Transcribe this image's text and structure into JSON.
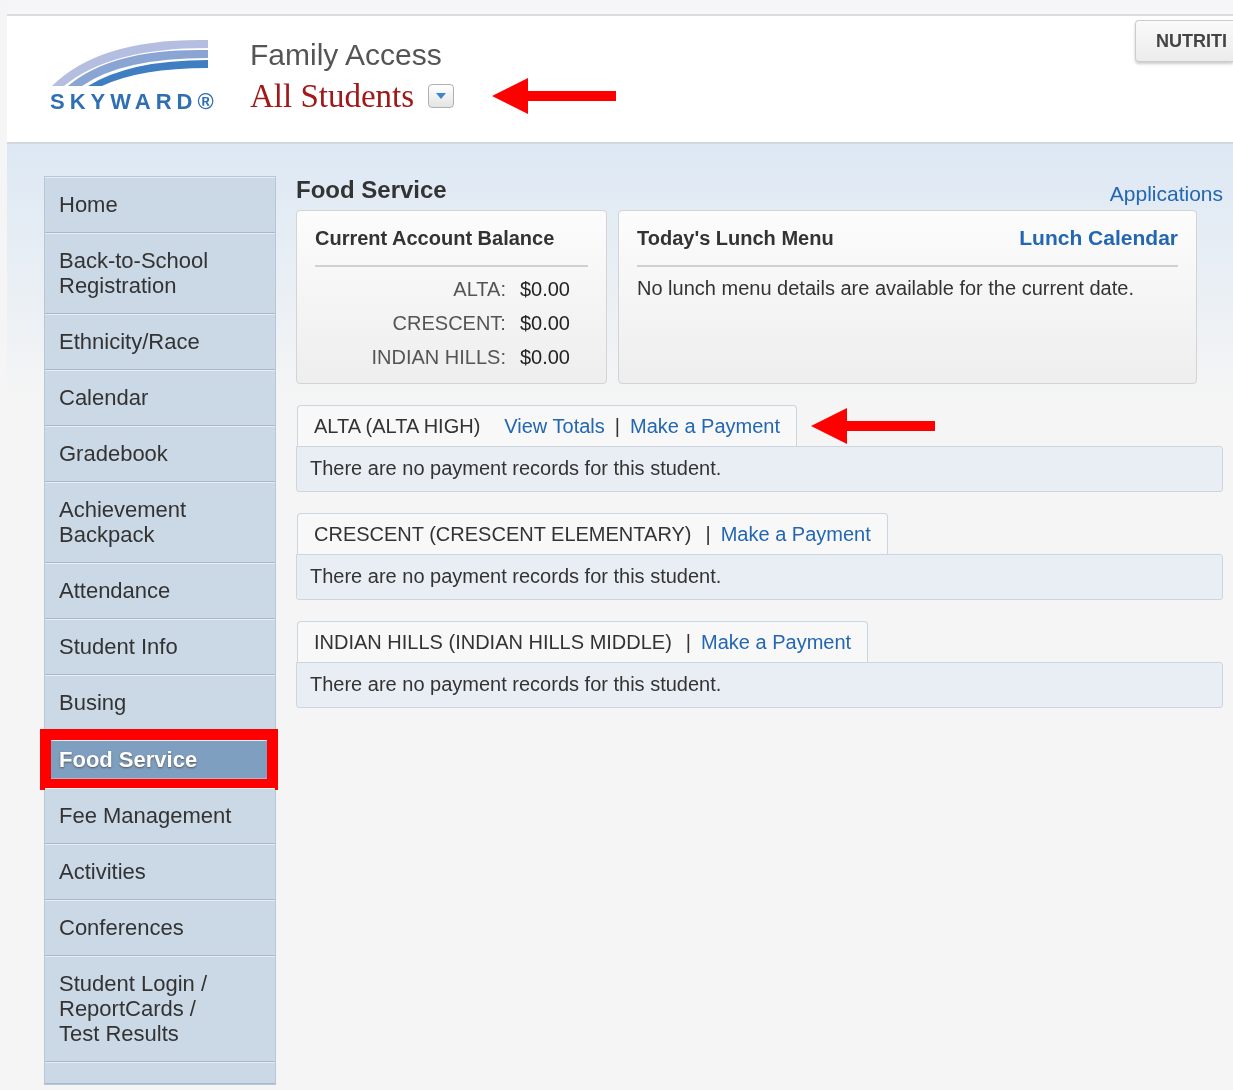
{
  "header": {
    "logo_text": "SKYWARD®",
    "app_title": "Family Access",
    "student_selector": "All Students",
    "nutrition_button": "NUTRITI"
  },
  "sidebar": {
    "items": [
      {
        "label": "Home",
        "selected": false,
        "highlighted": false
      },
      {
        "label": "Back-to-School Registration",
        "selected": false,
        "highlighted": false
      },
      {
        "label": "Ethnicity/Race",
        "selected": false,
        "highlighted": false
      },
      {
        "label": "Calendar",
        "selected": false,
        "highlighted": false
      },
      {
        "label": "Gradebook",
        "selected": false,
        "highlighted": false
      },
      {
        "label": "Achievement Backpack",
        "selected": false,
        "highlighted": false
      },
      {
        "label": "Attendance",
        "selected": false,
        "highlighted": false
      },
      {
        "label": "Student Info",
        "selected": false,
        "highlighted": false
      },
      {
        "label": "Busing",
        "selected": false,
        "highlighted": false
      },
      {
        "label": "Food Service",
        "selected": true,
        "highlighted": true
      },
      {
        "label": "Fee Management",
        "selected": false,
        "highlighted": false
      },
      {
        "label": "Activities",
        "selected": false,
        "highlighted": false
      },
      {
        "label": "Conferences",
        "selected": false,
        "highlighted": false
      },
      {
        "label": "Student Login / ReportCards / Test Results",
        "selected": false,
        "highlighted": false
      }
    ]
  },
  "main": {
    "title": "Food Service",
    "applications_link": "Applications",
    "balance_card": {
      "title": "Current Account Balance",
      "rows": [
        {
          "school": "ALTA:",
          "amount": "$0.00"
        },
        {
          "school": "CRESCENT:",
          "amount": "$0.00"
        },
        {
          "school": "INDIAN HILLS:",
          "amount": "$0.00"
        }
      ]
    },
    "lunch_card": {
      "title": "Today's Lunch Menu",
      "link": "Lunch Calendar",
      "message": "No lunch menu details are available for the current date."
    },
    "schools": [
      {
        "name": "ALTA (ALTA HIGH)",
        "links": [
          {
            "kind": "link",
            "text": "View Totals"
          },
          {
            "kind": "separator",
            "text": "|"
          },
          {
            "kind": "link",
            "text": "Make a Payment"
          }
        ],
        "message": "There are no payment records for this student.",
        "arrow": true
      },
      {
        "name": "CRESCENT (CRESCENT ELEMENTARY)",
        "links": [
          {
            "kind": "separator",
            "text": "|"
          },
          {
            "kind": "link",
            "text": "Make a Payment"
          }
        ],
        "message": "There are no payment records for this student.",
        "arrow": false
      },
      {
        "name": "INDIAN HILLS (INDIAN HILLS MIDDLE)",
        "links": [
          {
            "kind": "separator",
            "text": "|"
          },
          {
            "kind": "link",
            "text": "Make a Payment"
          }
        ],
        "message": "There are no payment records for this student.",
        "arrow": false
      }
    ]
  }
}
